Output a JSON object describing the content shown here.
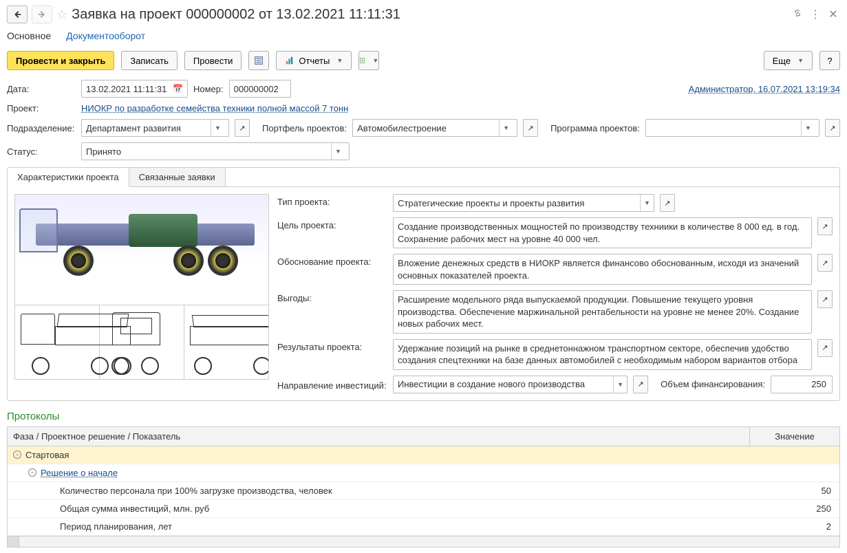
{
  "header": {
    "title": "Заявка на проект 000000002 от 13.02.2021 11:11:31"
  },
  "section_tabs": {
    "main": "Основное",
    "docflow": "Документооборот"
  },
  "toolbar": {
    "post_close": "Провести и закрыть",
    "save": "Записать",
    "post": "Провести",
    "reports": "Отчеты",
    "more": "Еще"
  },
  "form": {
    "date_label": "Дата:",
    "date_value": "13.02.2021 11:11:31",
    "number_label": "Номер:",
    "number_value": "000000002",
    "modified_info": "Администратор, 16.07.2021 13:19:34",
    "project_label": "Проект:",
    "project_value": "НИОКР по разработке семейства техники полной массой 7 тонн",
    "dept_label": "Подразделение:",
    "dept_value": "Департамент развития",
    "portfolio_label": "Портфель проектов:",
    "portfolio_value": "Автомобилестроение",
    "program_label": "Программа проектов:",
    "program_value": "",
    "status_label": "Статус:",
    "status_value": "Принято"
  },
  "tabs": {
    "characteristics": "Характеристики проекта",
    "related": "Связанные заявки"
  },
  "props": {
    "type_label": "Тип проекта:",
    "type_value": "Стратегические проекты и проекты развития",
    "goal_label": "Цель проекта:",
    "goal_value": "Создание производственных мощностей по производству техниики в количестве 8 000 ед. в год. Сохранение рабочих мест на уровне 40 000 чел.",
    "basis_label": "Обоснование проекта:",
    "basis_value": "Вложение денежных средств в НИОКР является финансово обоснованным, исходя из значений основных показателей проекта.",
    "benefits_label": "Выгоды:",
    "benefits_value": "Расширение модельного ряда выпускаемой продукции. Повышение текущего уровня производства. Обеспечение маржинальной рентабельности на уровне не менее 20%. Создание новых рабочих мест.",
    "results_label": "Результаты проекта:",
    "results_value": "Удержание позиций на рынке в среднетоннажном транспортном секторе, обеспечив удобство создания спецтехники на базе данных автомобилей с необходимым набором вариантов отбора",
    "invest_dir_label": "Направление инвестиций:",
    "invest_dir_value": "Инвестиции в создание нового производства",
    "funding_label": "Объем финансирования:",
    "funding_value": "250"
  },
  "protocols": {
    "title": "Протоколы",
    "col_main": "Фаза / Проектное решение / Показатель",
    "col_value": "Значение",
    "rows": [
      {
        "indent": 0,
        "toggle": "−",
        "label": "Стартовая",
        "value": "",
        "highlight": true
      },
      {
        "indent": 1,
        "toggle": "−",
        "label": "Решение о начале",
        "value": "",
        "link": true
      },
      {
        "indent": 2,
        "label": "Количество персонала при 100% загрузке производства, человек",
        "value": "50"
      },
      {
        "indent": 2,
        "label": "Общая сумма инвестиций, млн. руб",
        "value": "250"
      },
      {
        "indent": 2,
        "label": "Период планирования, лет",
        "value": "2"
      }
    ]
  }
}
